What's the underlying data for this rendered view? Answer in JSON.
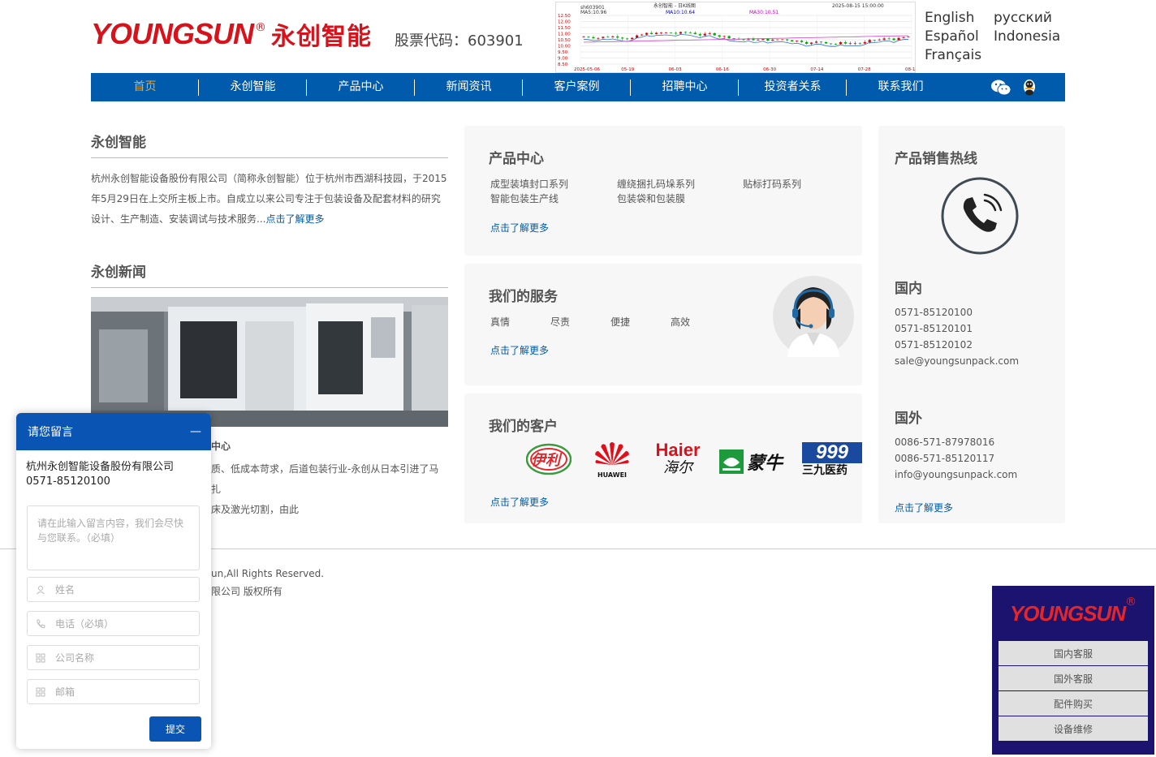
{
  "header": {
    "logo_en": "YOUNGSUN",
    "logo_reg": "®",
    "logo_cn": "永创智能",
    "stock_code": "股票代码：603901",
    "languages": [
      "English",
      "русский",
      "Español",
      "Indonesia",
      "Français"
    ]
  },
  "stock_chart": {
    "code_label": "sh603901",
    "title": "永创智能 - 日K线图",
    "ma5": "MA5:10.96",
    "ma10": "MA10:10.64",
    "ma30": "MA30:10.51",
    "timestamp": "2025-08-15 15:00:00",
    "y_ticks": [
      "12.50",
      "12.00",
      "11.50",
      "11.00",
      "10.50",
      "10.00",
      "9.50",
      "9.00",
      "8.50"
    ],
    "x_ticks": [
      "2025-05-06",
      "05-19",
      "06-03",
      "06-16",
      "06-30",
      "07-14",
      "07-28",
      "08-15"
    ]
  },
  "nav": {
    "items": [
      "首页",
      "永创智能",
      "产品中心",
      "新闻资讯",
      "客户案例",
      "招聘中心",
      "投资者关系",
      "联系我们"
    ]
  },
  "about": {
    "title": "永创智能",
    "text": "杭州永创智能设备股份有限公司（简称永创智能）位于杭州市西湖科技园，于2015年5月29日在上交所主板上市。自成立以来公司专注于包装设备及配套材料的研究设计、生产制造、安装调试与技术服务...",
    "more": "点击了解更多"
  },
  "news": {
    "title": "永创新闻",
    "headline_tail": "中心",
    "text_line1": "质、低成本苛求，后道包装行业-永创从日本引进了马扎",
    "text_line2": "床及激光切割，由此"
  },
  "products": {
    "title": "产品中心",
    "items": [
      "成型装填封口系列",
      "缠绕捆扎码垛系列",
      "贴标打码系列",
      "智能包装生产线",
      "包装袋和包装膜"
    ],
    "more": "点击了解更多"
  },
  "services": {
    "title": "我们的服务",
    "items": [
      "真情",
      "尽责",
      "便捷",
      "高效"
    ],
    "more": "点击了解更多"
  },
  "customers": {
    "title": "我们的客户",
    "logos": [
      "伊利",
      "HUAWEI",
      "Haier",
      "海尔",
      "蒙牛",
      "999",
      "三九医药"
    ],
    "more": "点击了解更多"
  },
  "hotline": {
    "title": "产品销售热线",
    "domestic_title": "国内",
    "domestic": [
      "0571-85120100",
      "0571-85120101",
      "0571-85120102",
      "sale@youngsunpack.com"
    ],
    "overseas_title": "国外",
    "overseas": [
      "0086-571-87978016",
      "0086-571-85120117",
      "info@youngsunpack.com"
    ],
    "more": "点击了解更多"
  },
  "footer": {
    "line1": "un,All Rights Reserved.",
    "line2": "限公司 版权所有"
  },
  "chat": {
    "title": "请您留言",
    "minimize": "—",
    "company": "杭州永创智能设备股份有限公司",
    "phone": "0571-85120100",
    "message_placeholder": "请在此输入留言内容，我们会尽快与您联系。（必填）",
    "name_placeholder": "姓名",
    "tel_placeholder": "电话（必填）",
    "company_placeholder": "公司名称",
    "email_placeholder": "邮箱",
    "submit": "提交"
  },
  "service_box": {
    "logo": "YOUNGSUN",
    "logo_reg": "®",
    "buttons": [
      "国内客服",
      "国外客服",
      "配件购买",
      "设备维修"
    ]
  }
}
